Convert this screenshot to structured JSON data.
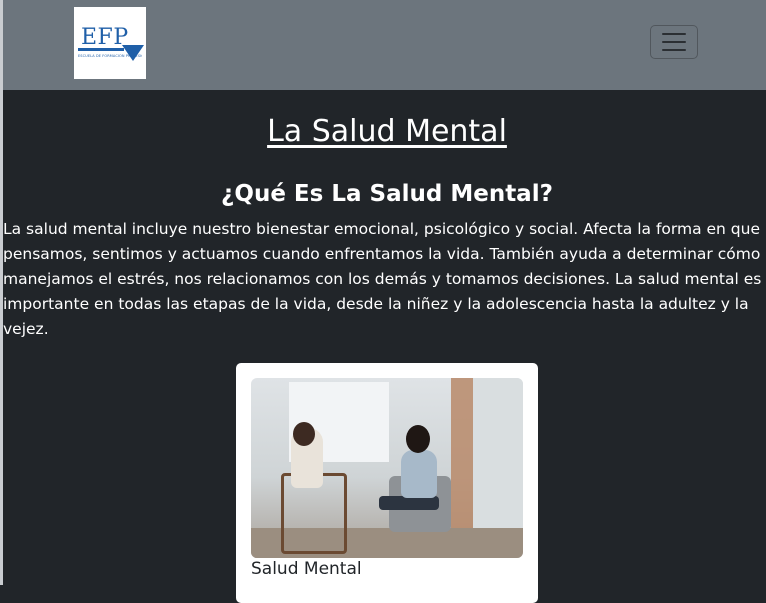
{
  "navbar": {
    "logo": {
      "text": "EFP",
      "subtitle": "ESCUELA DE FORMACIÓN PROFESIONAL"
    },
    "toggler_icon": "hamburger-icon"
  },
  "main": {
    "title": "La Salud Mental",
    "subtitle": "¿Qué Es La Salud Mental?",
    "intro": "La salud mental incluye nuestro bienestar emocional, psicológico y social. Afecta la forma en que pensamos, sentimos y actuamos cuando enfrentamos la vida. También ayuda a determinar cómo manejamos el estrés, nos relacionamos con los demás y tomamos decisiones. La salud mental es importante en todas las etapas de la vida, desde la niñez y la adolescencia hasta la adultez y la vejez."
  },
  "card": {
    "image": "therapy-session-photo",
    "title": "Salud Mental"
  },
  "colors": {
    "navbar_bg": "#6c757d",
    "page_bg": "#212529",
    "logo_blue": "#1f5fa8"
  }
}
